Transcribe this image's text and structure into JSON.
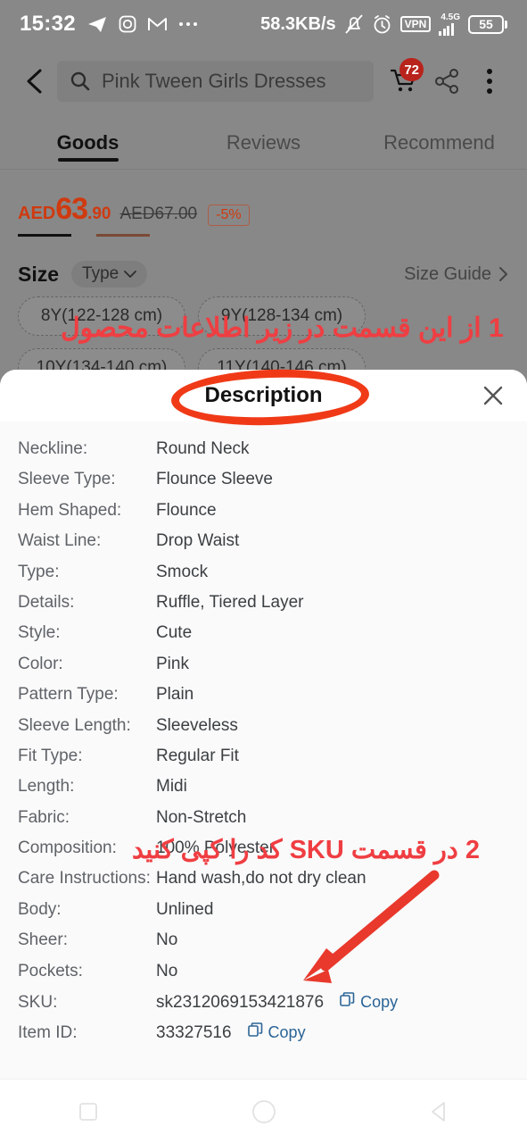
{
  "status_bar": {
    "time": "15:32",
    "net_speed": "58.3KB/s",
    "vpn_label": "VPN",
    "network_type": "4.5G",
    "battery_level": "55",
    "left_icons": [
      "telegram-icon",
      "instagram-icon",
      "gmail-icon",
      "more-apps-icon"
    ],
    "right_icons": [
      "bell-muted-icon",
      "alarm-icon",
      "vpn-icon",
      "signal-icon",
      "battery-icon"
    ]
  },
  "header": {
    "back_icon": "chevron-left-icon",
    "search_value": "Pink Tween Girls Dresses",
    "search_icon": "search-icon",
    "cart_icon": "cart-icon",
    "cart_badge": "72",
    "share_icon": "share-icon",
    "menu_icon": "more-vertical-icon"
  },
  "tabs": [
    {
      "label": "Goods",
      "active": true
    },
    {
      "label": "Reviews",
      "active": false
    },
    {
      "label": "Recommend",
      "active": false
    }
  ],
  "product": {
    "currency": "AED",
    "price_int": "63",
    "price_dec": ".90",
    "old_price": "AED67.00",
    "discount": "-5%"
  },
  "size_section": {
    "title": "Size",
    "type_chip": "Type",
    "type_chip_icon": "chevron-down-icon",
    "size_guide": "Size Guide",
    "size_guide_icon": "chevron-right-icon",
    "options": [
      "8Y(122-128 cm)",
      "9Y(128-134 cm)",
      "10Y(134-140 cm)",
      "11Y(140-146 cm)"
    ]
  },
  "sheet": {
    "title": "Description",
    "close_icon": "close-icon",
    "copy_label": "Copy",
    "copy_icon": "copy-icon",
    "attributes": [
      {
        "key": "Neckline:",
        "value": "Round Neck"
      },
      {
        "key": "Sleeve Type:",
        "value": "Flounce Sleeve"
      },
      {
        "key": "Hem Shaped:",
        "value": "Flounce"
      },
      {
        "key": "Waist Line:",
        "value": "Drop Waist"
      },
      {
        "key": "Type:",
        "value": "Smock"
      },
      {
        "key": "Details:",
        "value": "Ruffle, Tiered Layer"
      },
      {
        "key": "Style:",
        "value": "Cute"
      },
      {
        "key": "Color:",
        "value": "Pink"
      },
      {
        "key": "Pattern Type:",
        "value": "Plain"
      },
      {
        "key": "Sleeve Length:",
        "value": "Sleeveless"
      },
      {
        "key": "Fit Type:",
        "value": "Regular Fit"
      },
      {
        "key": "Length:",
        "value": "Midi"
      },
      {
        "key": "Fabric:",
        "value": "Non-Stretch"
      },
      {
        "key": "Composition:",
        "value": "100% Polyester"
      },
      {
        "key": "Care Instructions:",
        "value": "Hand wash,do not dry clean"
      },
      {
        "key": "Body:",
        "value": "Unlined"
      },
      {
        "key": "Sheer:",
        "value": "No"
      },
      {
        "key": "Pockets:",
        "value": "No"
      }
    ],
    "sku": {
      "key": "SKU:",
      "value": "sk2312069153421876"
    },
    "item_id": {
      "key": "Item ID:",
      "value": "33327516"
    }
  },
  "annotations": {
    "note_1": "1 از این قسمت در زیر اطلاعات محصول",
    "note_2": "2 در قسمت SKU کد را کپی کنید",
    "highlight_color": "#f03a17",
    "text_color": "#ef3e42"
  },
  "nav_bar": {
    "recents_icon": "square-icon",
    "home_icon": "circle-icon",
    "back_icon": "triangle-back-icon"
  }
}
